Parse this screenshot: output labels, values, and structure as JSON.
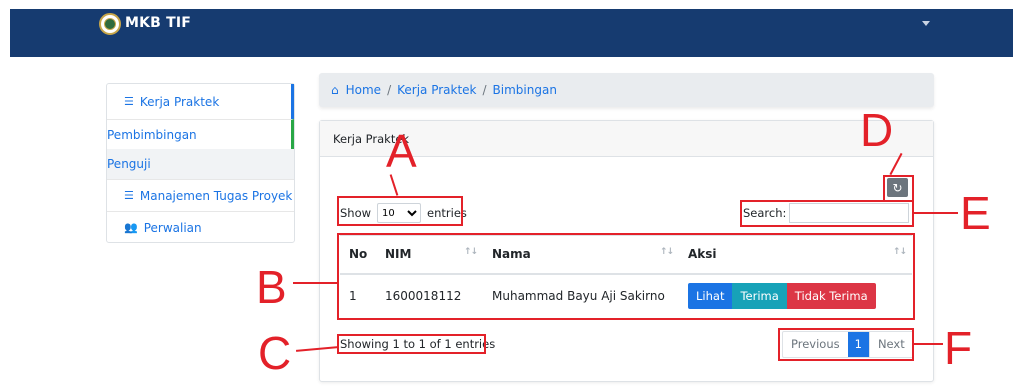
{
  "navbar": {
    "brand": "MKB TIF"
  },
  "sidebar": {
    "items": [
      {
        "label": "Kerja Praktek",
        "icon": "list-check-icon"
      },
      {
        "label": "Pembimbingan"
      },
      {
        "label": "Penguji"
      },
      {
        "label": "Manajemen Tugas Proyek",
        "icon": "list-check-icon"
      },
      {
        "label": "Perwalian",
        "icon": "users-icon"
      }
    ]
  },
  "breadcrumb": {
    "items": [
      "Home",
      "Kerja Praktek",
      "Bimbingan"
    ],
    "separator": "/"
  },
  "card": {
    "title": "Kerja Praktek"
  },
  "toolbar": {
    "refresh_icon": "refresh-icon"
  },
  "length": {
    "prefix": "Show",
    "value": "10",
    "suffix": "entries"
  },
  "search": {
    "label": "Search:",
    "value": ""
  },
  "table": {
    "headers": [
      "No",
      "NIM",
      "Nama",
      "Aksi"
    ],
    "rows": [
      {
        "no": "1",
        "nim": "1600018112",
        "nama": "Muhammad Bayu Aji Sakirno"
      }
    ],
    "actions": [
      "Lihat",
      "Terima",
      "Tidak Terima"
    ]
  },
  "info": "Showing 1 to 1 of 1 entries",
  "pagination": {
    "previous": "Previous",
    "current": "1",
    "next": "Next"
  },
  "annotations": {
    "a": "A",
    "b": "B",
    "c": "C",
    "d": "D",
    "e": "E",
    "f": "F"
  },
  "colors": {
    "navbar": "#163b70",
    "primary": "#1b74e4",
    "info": "#17a2b8",
    "danger": "#dc3545",
    "annotation": "#e32129"
  }
}
